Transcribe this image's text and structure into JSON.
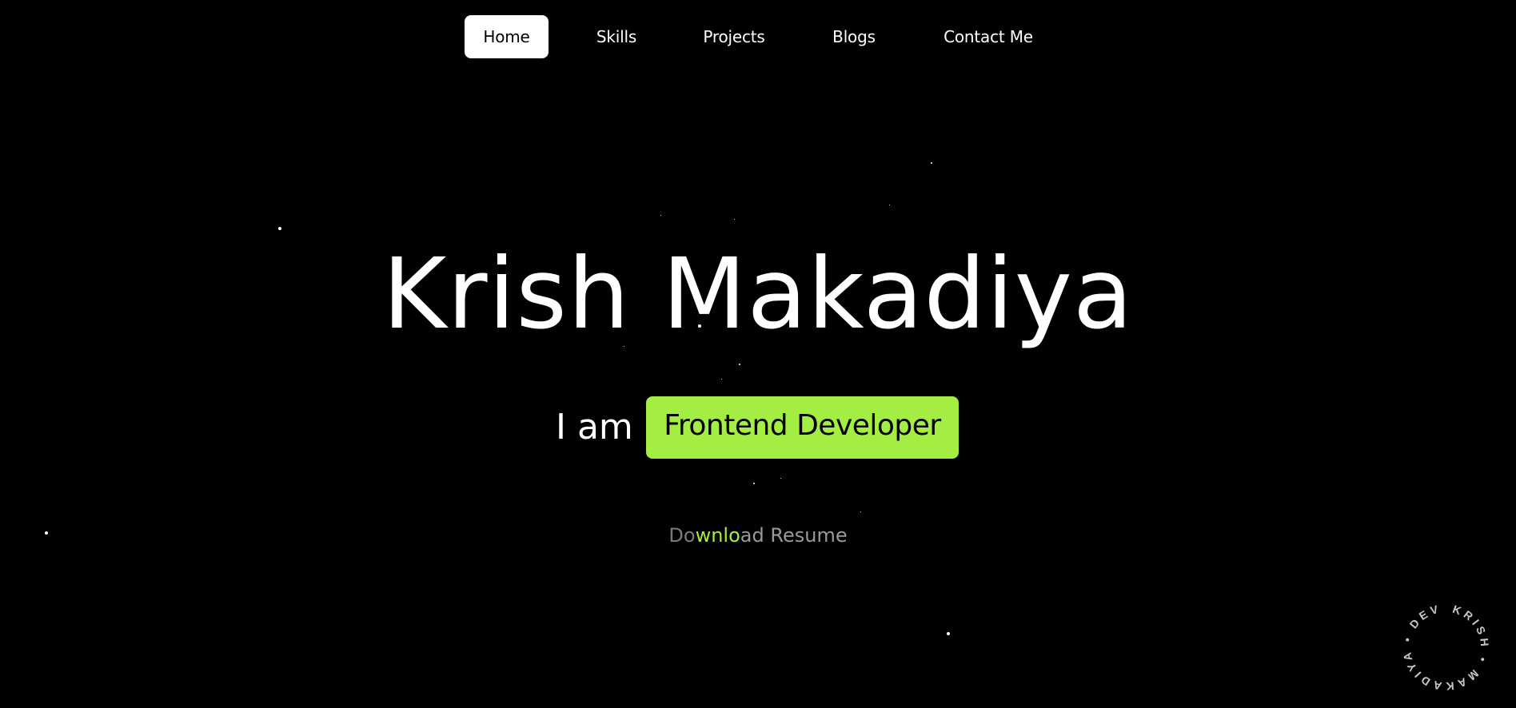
{
  "nav": {
    "items": [
      {
        "label": "Home",
        "active": true
      },
      {
        "label": "Skills",
        "active": false
      },
      {
        "label": "Projects",
        "active": false
      },
      {
        "label": "Blogs",
        "active": false
      },
      {
        "label": "Contact Me",
        "active": false
      }
    ]
  },
  "hero": {
    "name": "Krish Makadiya",
    "tagline_prefix": "I am",
    "role": "Frontend Developer",
    "download": {
      "part1": "Do",
      "part2": "wnlo",
      "part3": "ad",
      "part4": " Resume"
    }
  },
  "badge": {
    "circle_text": "KRISH • MAKADIYA • DEV •"
  },
  "colors": {
    "background": "#000000",
    "accent": "#a4ee44",
    "text": "#ffffff",
    "muted": "#7a7a7a"
  }
}
